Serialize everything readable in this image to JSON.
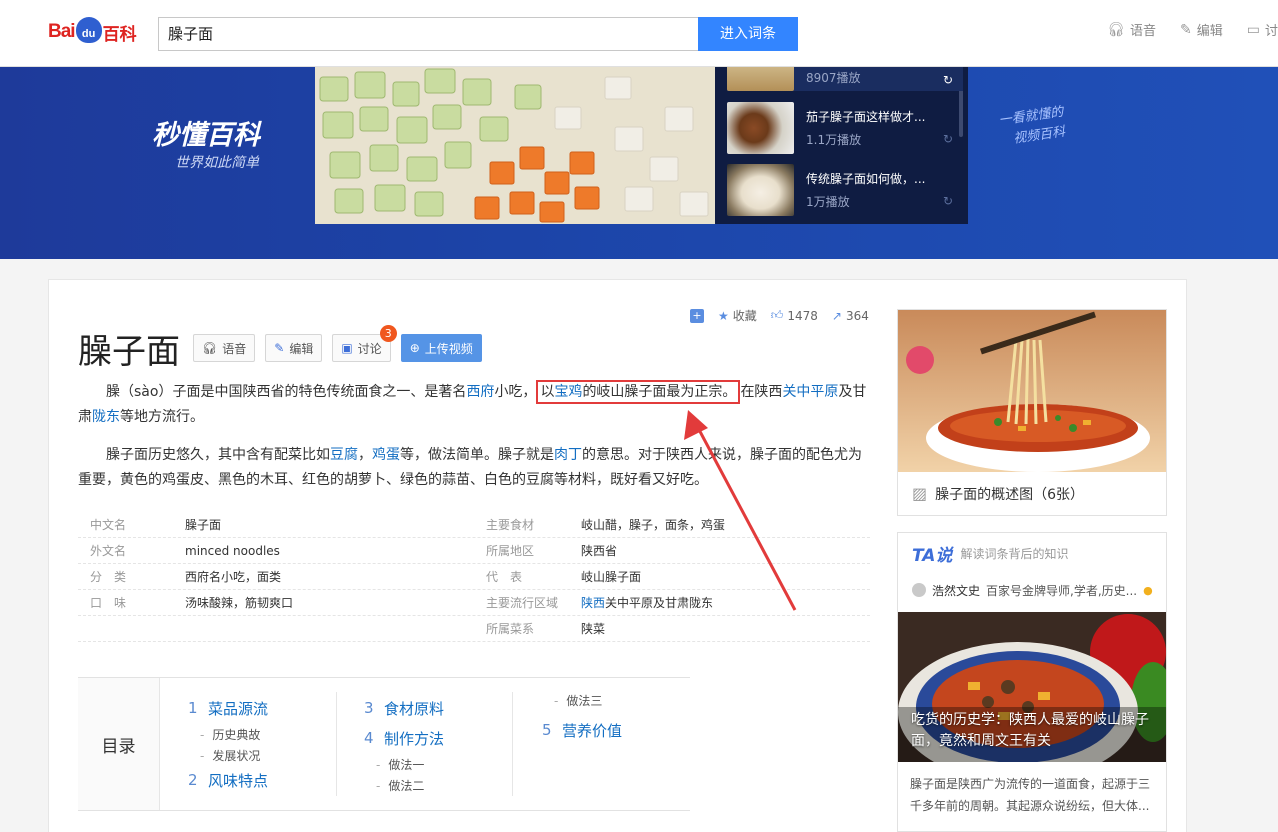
{
  "header": {
    "logo_part1": "Bai",
    "logo_paw": "du",
    "logo_part2": "百科",
    "search_value": "臊子面",
    "search_button": "进入词条",
    "actions": [
      {
        "label": "语音",
        "icon": "headphone-icon"
      },
      {
        "label": "编辑",
        "icon": "pencil-icon"
      },
      {
        "label": "讨",
        "icon": "comment-icon"
      }
    ]
  },
  "banner": {
    "logo_text": "秒懂百科",
    "slogan": "世界如此简单",
    "handwriting_line1": "一看就懂的",
    "handwriting_line2": "视频百科",
    "videos": [
      {
        "title": "",
        "plays": "8907播放"
      },
      {
        "title": "茄子臊子面这样做才...",
        "plays": "1.1万播放"
      },
      {
        "title": "传统臊子面如何做，...",
        "plays": "1万播放"
      }
    ]
  },
  "stats": {
    "collect": "收藏",
    "likes": "1478",
    "shares": "364"
  },
  "entry": {
    "title": "臊子面",
    "buttons": {
      "voice": "语音",
      "edit": "编辑",
      "discuss": "讨论",
      "discuss_badge": "3",
      "upload": "上传视频"
    },
    "para1": {
      "t1": "臊（sào）子面是中国陕西省的特色传统面食之一、是著名",
      "l1": "西府",
      "t2": "小吃，",
      "h_pre": "以",
      "h_link": "宝鸡",
      "h_post": "的岐山臊子面最为正宗。",
      "t3": "在陕西",
      "l2": "关中平原",
      "t4": "及甘肃",
      "l3": "陇东",
      "t5": "等地方流行。"
    },
    "para2": {
      "t1": "臊子面历史悠久，其中含有配菜比如",
      "l1": "豆腐",
      "t2": "，",
      "l2": "鸡蛋",
      "t3": "等，做法简单。臊子就是",
      "l3": "肉丁",
      "t4": "的意思。对于陕西人来说，臊子面的配色尤为重要，黄色的鸡蛋皮、黑色的木耳、红色的胡萝卜、绿色的蒜苗、白色的豆腐等材料，既好看又好吃。"
    }
  },
  "infobox": {
    "left": [
      {
        "k": "中文名",
        "v": "臊子面"
      },
      {
        "k": "外文名",
        "v": "minced noodles"
      },
      {
        "k": "分　类",
        "v": "西府名小吃，面类"
      },
      {
        "k": "口　味",
        "v": "汤味酸辣，筋韧爽口"
      }
    ],
    "right": [
      {
        "k": "主要食材",
        "v": "岐山醋，臊子，面条，鸡蛋"
      },
      {
        "k": "所属地区",
        "v": "陕西省"
      },
      {
        "k": "代　表",
        "v": "岐山臊子面"
      },
      {
        "k": "主要流行区域",
        "v_link": "陕西",
        "v": "关中平原及甘肃陇东"
      },
      {
        "k": "所属菜系",
        "v": "陕菜"
      }
    ]
  },
  "toc": {
    "label": "目录",
    "sections": [
      {
        "n": "1",
        "title": "菜品源流",
        "subs": [
          "历史典故",
          "发展状况"
        ]
      },
      {
        "n": "2",
        "title": "风味特点",
        "subs": []
      },
      {
        "n": "3",
        "title": "食材原料",
        "subs": []
      },
      {
        "n": "4",
        "title": "制作方法",
        "subs": [
          "做法一",
          "做法二",
          "做法三"
        ]
      },
      {
        "n": "5",
        "title": "营养价值",
        "subs": []
      }
    ]
  },
  "sidebar": {
    "album_caption": "臊子面的概述图（6张）",
    "ta_logo": "TA说",
    "ta_tagline": "解读词条背后的知识",
    "ta_author": "浩然文史",
    "ta_author_desc": "百家号金牌导师,学者,历史...",
    "ta_article_title": "吃货的历史学：陕西人最爱的岐山臊子面，竟然和周文王有关",
    "ta_article_desc": "臊子面是陕西广为流传的一道面食，起源于三千多年前的周朝。其起源众说纷纭，但大体..."
  },
  "colors": {
    "accent_blue": "#3385ff",
    "link_blue": "#136ec2",
    "annotation_red": "#e23b3b",
    "banner_blue": "#1e3a9a"
  }
}
